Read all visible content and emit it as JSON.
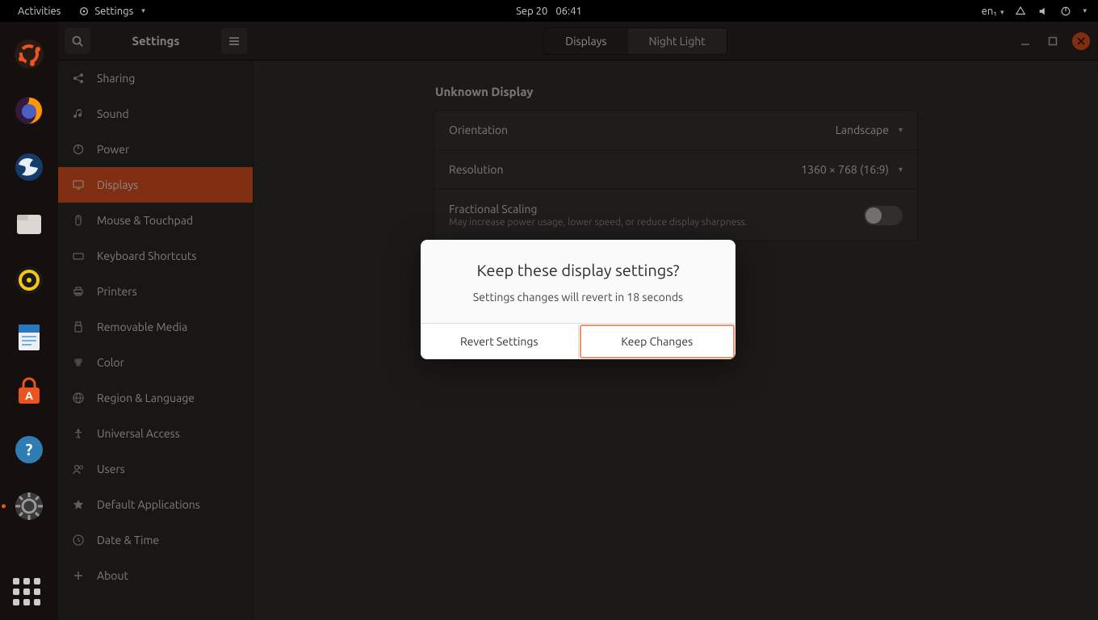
{
  "topbar": {
    "activities": "Activities",
    "appmenu": "Settings",
    "date": "Sep 20",
    "time": "06:41",
    "lang": "en₁"
  },
  "window": {
    "title": "Settings",
    "tabs": {
      "displays": "Displays",
      "night_light": "Night Light"
    }
  },
  "sidebar": {
    "items": [
      {
        "id": "sharing",
        "label": "Sharing"
      },
      {
        "id": "sound",
        "label": "Sound"
      },
      {
        "id": "power",
        "label": "Power"
      },
      {
        "id": "displays",
        "label": "Displays"
      },
      {
        "id": "mouse",
        "label": "Mouse & Touchpad"
      },
      {
        "id": "keyboard",
        "label": "Keyboard Shortcuts"
      },
      {
        "id": "printers",
        "label": "Printers"
      },
      {
        "id": "removable",
        "label": "Removable Media"
      },
      {
        "id": "color",
        "label": "Color"
      },
      {
        "id": "region",
        "label": "Region & Language"
      },
      {
        "id": "accessibility",
        "label": "Universal Access"
      },
      {
        "id": "users",
        "label": "Users"
      },
      {
        "id": "defaults",
        "label": "Default Applications"
      },
      {
        "id": "datetime",
        "label": "Date & Time"
      },
      {
        "id": "about",
        "label": "About"
      }
    ]
  },
  "content": {
    "section_title": "Unknown Display",
    "orientation": {
      "label": "Orientation",
      "value": "Landscape"
    },
    "resolution": {
      "label": "Resolution",
      "value": "1360 × 768 (16:9)"
    },
    "scaling": {
      "label": "Fractional Scaling",
      "sub": "May increase power usage, lower speed, or reduce display sharpness."
    }
  },
  "dialog": {
    "title": "Keep these display settings?",
    "message": "Settings changes will revert in 18 seconds",
    "revert": "Revert Settings",
    "keep": "Keep Changes"
  }
}
